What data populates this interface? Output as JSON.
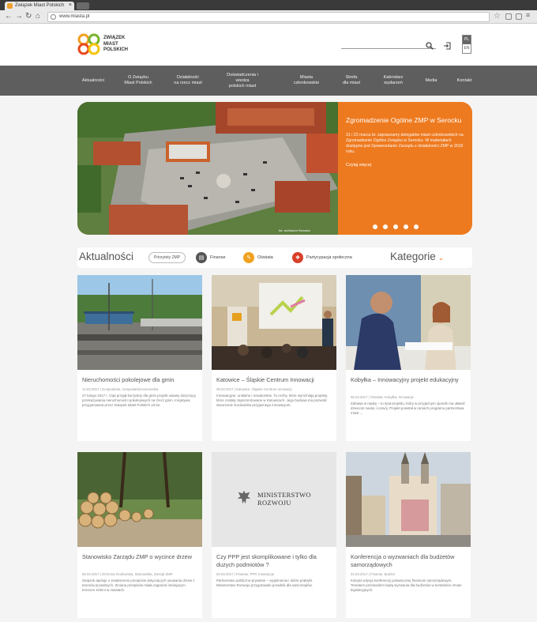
{
  "browser": {
    "tab_title": "Związek Miast Polskich",
    "tab_close": "×",
    "url": "www.miasta.pl"
  },
  "header": {
    "logo_lines": [
      "ZWIĄZEK",
      "MIAST",
      "POLSKICH"
    ],
    "lang_pl": "PL",
    "lang_en": "EN"
  },
  "menu": [
    {
      "label": "Aktualności"
    },
    {
      "label": "O Związku\nMiast Polskich"
    },
    {
      "label": "Działalność\nna rzecz miast"
    },
    {
      "label": "Doświadczenia i\nwiedza\npolskich miast"
    },
    {
      "label": "Miasta\nczłonkowskie"
    },
    {
      "label": "Strefa\ndla miast"
    },
    {
      "label": "Kalendarz\nwydarzeń"
    },
    {
      "label": "Media"
    },
    {
      "label": "Kontakt"
    }
  ],
  "hero": {
    "title": "Zgromadzenie Ogólne ZMP w Serocku",
    "body": "21 i 22 marca br. zapraszamy delegatów miast członkowskich na Zgromadzenie Ogólne Związku w Serocku. W materiałach dostępne jest Sprawozdanie Zarządu z działalności ZMP w 2016 roku.",
    "more": "Czytaj więcej",
    "caption": "fot. archiwum Serocka",
    "slides": 5,
    "active_slide": 1,
    "accent": "#ee7a1f"
  },
  "categories": {
    "title": "Aktualności",
    "chips": [
      {
        "label": "Priorytety ZMP",
        "type": "button"
      },
      {
        "label": "Finanse",
        "icon": "finance-icon",
        "color": "#555555"
      },
      {
        "label": "Oświata",
        "icon": "education-icon",
        "color": "#f0a020"
      },
      {
        "label": "Partycypacja społeczna",
        "icon": "participation-icon",
        "color": "#d8402a"
      }
    ],
    "dropdown_label": "Kategorie"
  },
  "cards": [
    {
      "title": "Nieruchomości pokolejowe dla gmin",
      "meta": "14.03.2017 | Gospodarka, Gospodarka komunalna",
      "excerpt": "27 lutego 2017 r. rząd przyjął korzystny dla gmin projekt ustawy dotyczący przekazywania nieruchomości pokolejowych na rzecz gmin. Inicjatywa przygotowana przez Związek Miast Polskich od lat.",
      "image": "railway-station"
    },
    {
      "title": "Katowice – Śląskie Centrum Innowacji",
      "meta": "08.03.2017 | Katowice, Śląskie Centrum Innowacji",
      "excerpt": "Innowacyjne, unikalne i nowatorskie. To cechy, które wyróżniają projekty, które zostały zaprezentowane w Katowicach. Jego budowa ma pozwolić stworzenie środowiska przyjaznego innowacjom.",
      "image": "conference-presentation"
    },
    {
      "title": "Kobyłka – Innowacyjny projekt edukacyjny",
      "meta": "06.03.2017 | Oświata, Kobyłka, Innowacje",
      "excerpt": "Zabawa w naukę – to tytuł projektu, który w przyjaznym sposób ma ułatwić dzieciom naukę i rozwój. Projekt powstał w ramach programu partnerstwa miast ...",
      "image": "meeting-people"
    },
    {
      "title": "Stanowisko Zarządu ZMP o wycince drzew",
      "meta": "06.03.2017 | Ochrona środowiska, Stanowiska, Zarząd ZMP",
      "excerpt": "Związek apeluje o zwiększenie przepisów dotyczących usuwania drzew z terenów prywatnych. Zmiana przepisów miała zagrażać istniejącym terenom zieleni w miastach.",
      "image": "cut-logs"
    },
    {
      "title": "Czy PPP jest skomplikowane i tylko dla dużych podmiotów ?",
      "meta": "03.03.2017 | Finanse, PPP, Inwestycje",
      "excerpt": "Partnerstwo publiczno-prywatne – wyjaśnienia i dobre praktyki. Ministerstwo Rozwoju przygotowało poradnik dla samorządów.",
      "image": "ministry-logo",
      "ministry_lines": [
        "MINISTERSTWO",
        "ROZWOJU"
      ]
    },
    {
      "title": "Konferencja o wyzwaniach dla budżetów samorządowych",
      "meta": "02.03.2017 | Finanse, Budżet",
      "excerpt": "Kolejna edycja konferencji poświęconej finansom samorządowym. Tematem przewodnim będą wyzwania dla budżetów w kontekście zmian legislacyjnych.",
      "image": "town-square"
    }
  ]
}
